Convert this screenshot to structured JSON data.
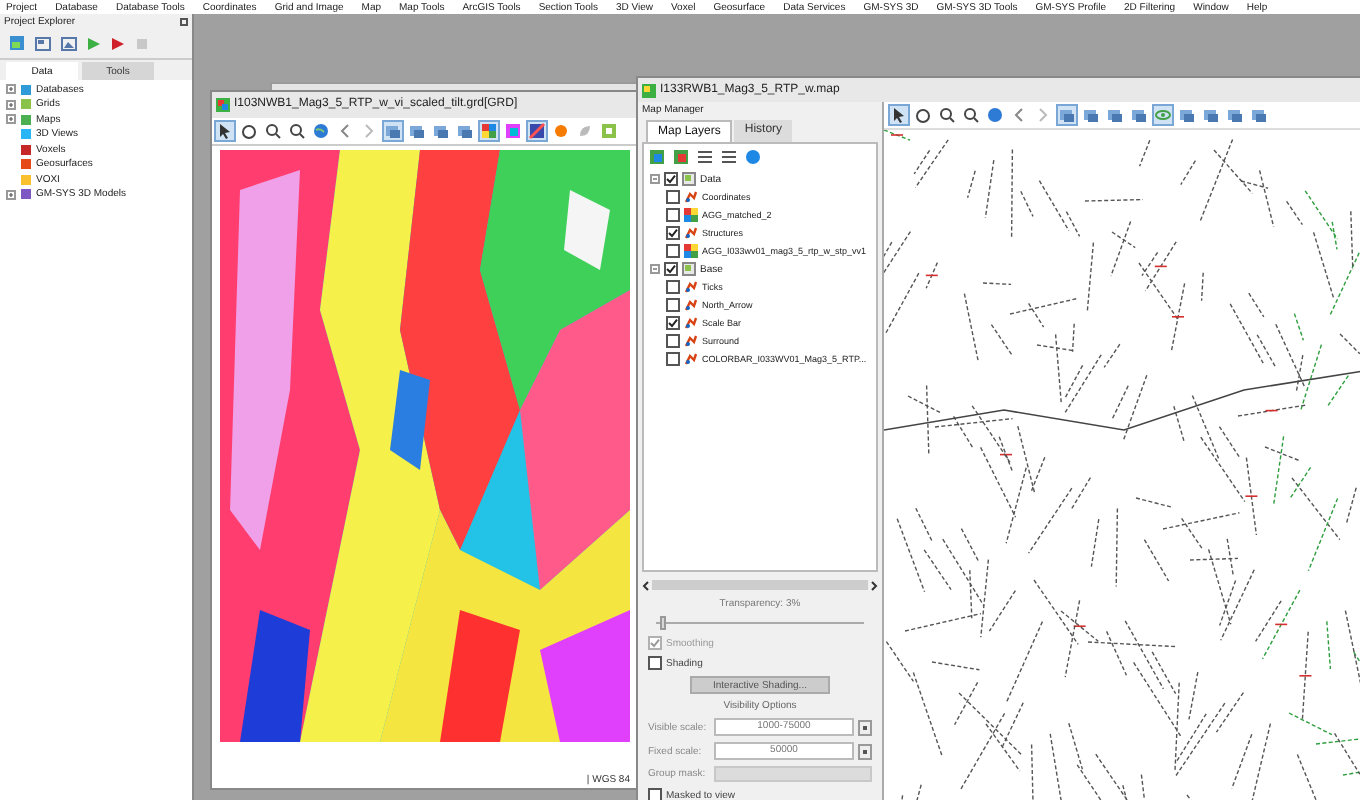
{
  "menu_bar": [
    "Project",
    "Database",
    "Database Tools",
    "Coordinates",
    "Grid and Image",
    "Map",
    "Map Tools",
    "ArcGIS Tools",
    "Section Tools",
    "3D View",
    "Voxel",
    "Geosurface",
    "Data Services",
    "GM-SYS 3D",
    "GM-SYS 3D Tools",
    "GM-SYS Profile",
    "2D Filtering",
    "Window",
    "Help"
  ],
  "project_explorer": {
    "title": "Project Explorer",
    "tabs": [
      {
        "label": "Data",
        "selected": true
      },
      {
        "label": "Tools",
        "selected": false
      }
    ],
    "tree": [
      {
        "label": "Databases",
        "expandable": true
      },
      {
        "label": "Grids",
        "expandable": true
      },
      {
        "label": "Maps",
        "expandable": true
      },
      {
        "label": "3D Views",
        "expandable": false
      },
      {
        "label": "Voxels",
        "expandable": false
      },
      {
        "label": "Geosurfaces",
        "expandable": false
      },
      {
        "label": "VOXI",
        "expandable": false
      },
      {
        "label": "GM-SYS 3D Models",
        "expandable": true
      }
    ]
  },
  "grid_window": {
    "title": "I103NWB1_Mag3_5_RTP_w_vi_scaled_tilt.grd[GRD]",
    "status": "| WGS 84"
  },
  "map_window": {
    "title": "I133RWB1_Mag3_5_RTP_w.map",
    "map_manager": {
      "title": "Map Manager",
      "tabs": [
        {
          "label": "Map Layers",
          "selected": true
        },
        {
          "label": "History",
          "selected": false
        }
      ],
      "layers": [
        {
          "label": "Data",
          "checked": true,
          "expanded": true,
          "children": [
            {
              "label": "Coordinates",
              "checked": false,
              "kind": "vector"
            },
            {
              "label": "AGG_matched_2",
              "checked": false,
              "kind": "grid"
            },
            {
              "label": "Structures",
              "checked": true,
              "kind": "vector"
            },
            {
              "label": "AGG_I033wv01_mag3_5_rtp_w_stp_vv1",
              "checked": false,
              "kind": "grid"
            }
          ]
        },
        {
          "label": "Base",
          "checked": true,
          "expanded": true,
          "children": [
            {
              "label": "Ticks",
              "checked": false,
              "kind": "vector"
            },
            {
              "label": "North_Arrow",
              "checked": false,
              "kind": "vector"
            },
            {
              "label": "Scale Bar",
              "checked": true,
              "kind": "vector"
            },
            {
              "label": "Surround",
              "checked": false,
              "kind": "vector"
            },
            {
              "label": "COLORBAR_I033WV01_Mag3_5_RTP...",
              "checked": false,
              "kind": "vector"
            }
          ]
        }
      ],
      "transparency": {
        "label": "Transparency: 3%",
        "level": 0.03
      },
      "smoothing": {
        "label": "Smoothing",
        "checked": true,
        "disabled": true
      },
      "shading": {
        "label": "Shading",
        "checked": false,
        "disabled": false
      },
      "shading_button": "Interactive Shading...",
      "visibility_heading": "Visibility Options",
      "visible_scale": {
        "label": "Visible scale:",
        "value": "1000-75000"
      },
      "fixed_scale": {
        "label": "Fixed scale:",
        "value": "50000"
      },
      "group_mask": {
        "label": "Group mask:"
      },
      "masked_to_view": {
        "label": "Masked to view",
        "checked": false
      }
    }
  }
}
